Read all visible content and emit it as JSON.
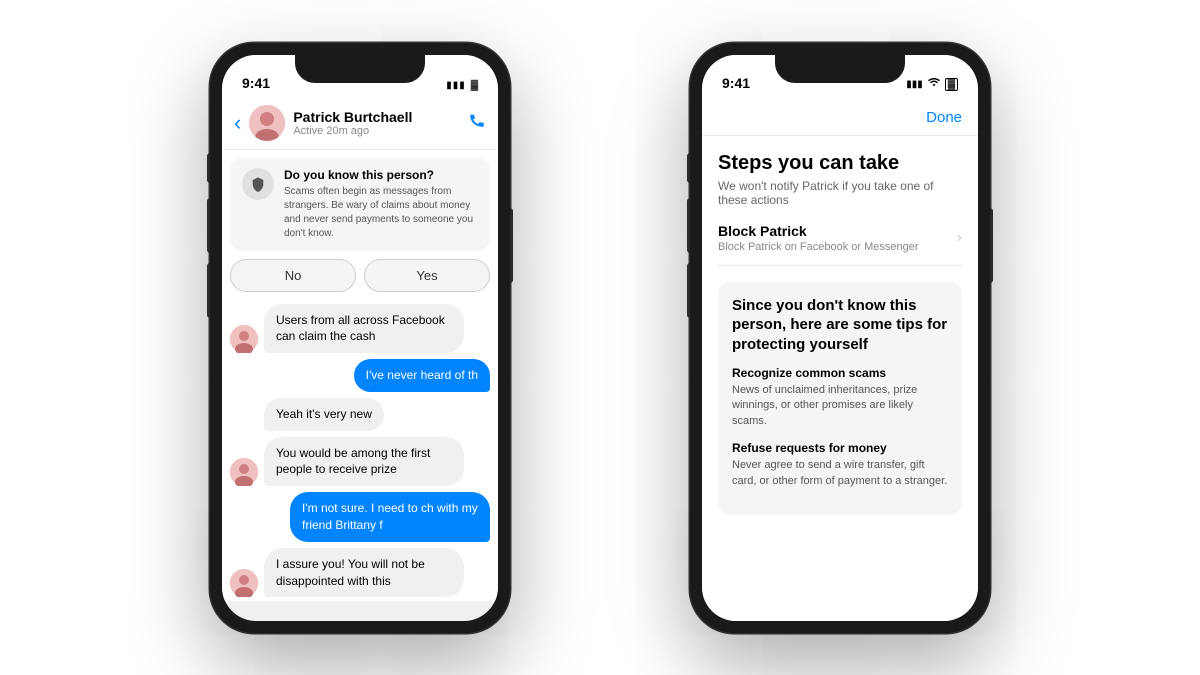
{
  "scene": {
    "background": "#ffffff"
  },
  "phone_left": {
    "status": {
      "time": "9:41",
      "signal": "●●●",
      "battery": "█"
    },
    "header": {
      "contact_name": "Patrick Burtchaell",
      "contact_status": "Active 20m ago",
      "back_label": "‹",
      "phone_icon": "📞"
    },
    "scam_banner": {
      "title": "Do you know this person?",
      "description": "Scams often begin as messages from strangers. Be wary of claims about money and never send payments to someone you don't know."
    },
    "yn_buttons": {
      "no": "No",
      "yes": "Yes"
    },
    "messages": [
      {
        "type": "received",
        "text": "Users from all across Facebook can claim the cash",
        "has_avatar": true
      },
      {
        "type": "sent",
        "text": "I've never heard of th"
      },
      {
        "type": "received",
        "text": "Yeah it's very new",
        "has_avatar": false
      },
      {
        "type": "received",
        "text": "You would be among the first people to receive prize",
        "has_avatar": true
      },
      {
        "type": "sent",
        "text": "I'm not sure. I need to ch with my friend Brittany f"
      },
      {
        "type": "received",
        "text": "I assure you! You will not be disappointed with this",
        "has_avatar": true
      }
    ]
  },
  "phone_right": {
    "status": {
      "time": "9:41",
      "signal": "●●●",
      "wifi": "wifi",
      "battery": "█"
    },
    "header": {
      "done_label": "Done"
    },
    "tips": {
      "title": "Steps you can take",
      "subtitle": "We won't notify Patrick if you take one of these actions",
      "block_section": {
        "title": "Block Patrick",
        "description": "Block Patrick on Facebook or Messenger"
      },
      "card": {
        "title": "Since you don't know this person, here are some tips for protecting yourself",
        "items": [
          {
            "title": "Recognize common scams",
            "description": "News of unclaimed inheritances, prize winnings, or other promises are likely scams."
          },
          {
            "title": "Refuse requests for money",
            "description": "Never agree to send a wire transfer, gift card, or other form of payment to a stranger."
          }
        ]
      }
    }
  }
}
